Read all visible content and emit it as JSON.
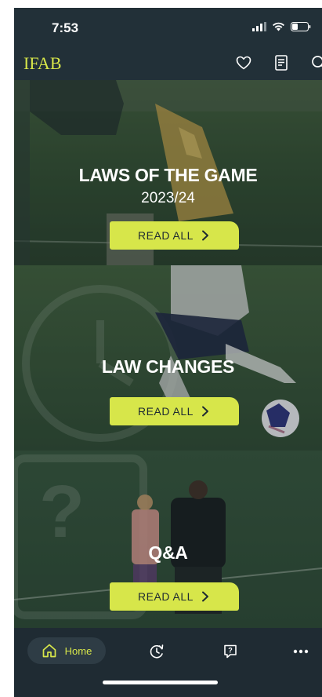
{
  "status_bar": {
    "time": "7:53",
    "icons": [
      "signal-icon",
      "wifi-icon",
      "battery-icon"
    ]
  },
  "header": {
    "logo": "IFAB",
    "icons": [
      "heart-icon",
      "document-icon",
      "search-icon"
    ]
  },
  "cards": [
    {
      "title": "LAWS OF THE GAME",
      "subtitle": "2023/24",
      "button_label": "READ ALL"
    },
    {
      "title": "LAW CHANGES",
      "button_label": "READ ALL"
    },
    {
      "title": "Q&A",
      "button_label": "READ ALL"
    }
  ],
  "bottom_nav": {
    "home_label": "Home",
    "items": [
      "home-icon",
      "history-icon",
      "quiz-icon",
      "more-icon"
    ]
  },
  "colors": {
    "accent": "#d7e64a",
    "background": "#223038",
    "nav_background": "#1f2b33"
  }
}
